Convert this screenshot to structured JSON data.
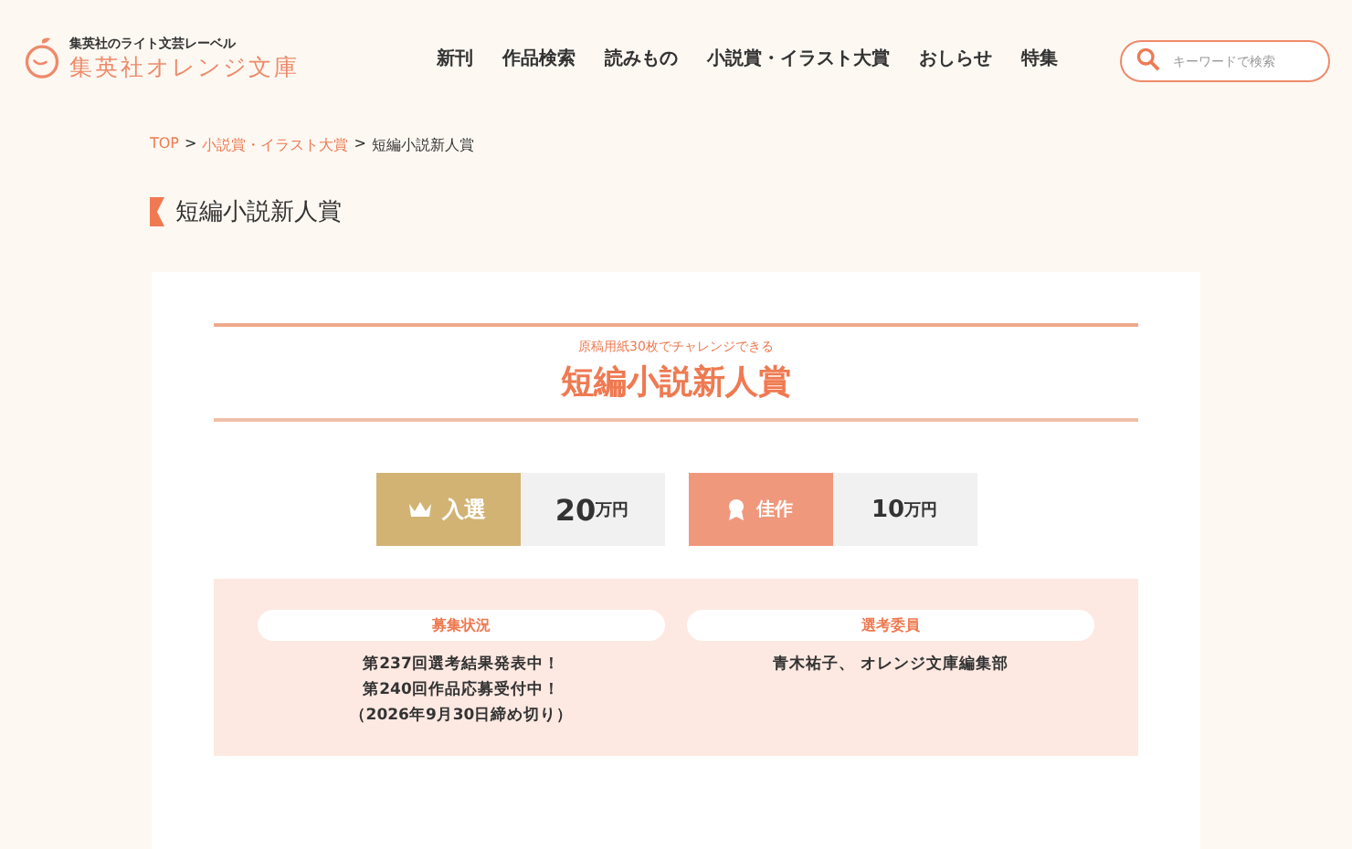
{
  "logo": {
    "tagline": "集英社のライト文芸レーベル",
    "name": "集英社オレンジ文庫"
  },
  "nav": [
    {
      "label": "新刊"
    },
    {
      "label": "作品検索"
    },
    {
      "label": "読みもの"
    },
    {
      "label": "小説賞・イラスト大賞"
    },
    {
      "label": "おしらせ"
    },
    {
      "label": "特集"
    }
  ],
  "search": {
    "placeholder": "キーワードで検索"
  },
  "breadcrumb": [
    {
      "label": "TOP",
      "link": true
    },
    {
      "separator": ">",
      "label": "小説賞・イラスト大賞",
      "link": true
    },
    {
      "separator": ">",
      "label": "短編小説新人賞",
      "link": false
    }
  ],
  "page_title": "短編小説新人賞",
  "award": {
    "subtitle": "原稿用紙30枚でチャレンジできる",
    "title": "短編小説新人賞"
  },
  "prizes": [
    {
      "kind": "winner",
      "label": "入選",
      "amount": "20",
      "unit": "万円"
    },
    {
      "kind": "runner_up",
      "label": "佳作",
      "amount": "10",
      "unit": "万円"
    }
  ],
  "info": [
    {
      "heading": "募集状況",
      "lines": [
        "第237回選考結果発表中！",
        "第240回作品応募受付中！",
        "（2026年9月30日締め切り）"
      ]
    },
    {
      "heading": "選考委員",
      "lines": [
        "青木祐子、 オレンジ文庫編集部"
      ]
    }
  ]
}
